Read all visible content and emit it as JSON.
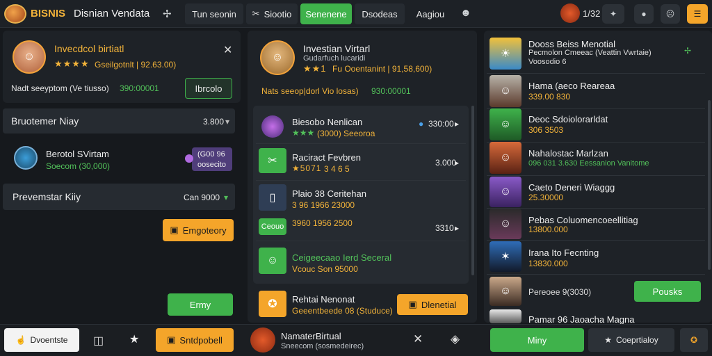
{
  "header": {
    "brand": "BISNIS",
    "title": "Disnian Vendata",
    "tabs": [
      "Tun seonin",
      "Siootio",
      "Senenene",
      "Dsodeas",
      "Aagiou"
    ],
    "counter": "1/32",
    "colors": {
      "accent": "#3fb24b",
      "brand": "#f4a52a"
    }
  },
  "left": {
    "profile_name": "Invecdcol birtiatl",
    "profile_stars": "★★★★",
    "profile_line": "Gseilgotnlt | 92.63.00)",
    "meta_text": "Nadt seeyptom (Ve tiusso)",
    "meta_value": "390:00001",
    "action_label": "Ibrcolo",
    "row1_title": "Bruotemer Niay",
    "row1_value": "3.800",
    "item_title": "Berotol SVirtam",
    "item_sub": "Soecom (30,000)",
    "item_badge_top": "(G00 96",
    "item_badge_bottom": "oosecito",
    "row2_title": "Prevemstar Kiiy",
    "row2_value": "Can 9000",
    "orange_btn": "Emgoteory",
    "green_btn": "Ermy",
    "footer_btn1": "Dvoentste",
    "footer_btn2": "Sntdpobell"
  },
  "middle": {
    "profile_name": "Investian Virtarl",
    "profile_sub": "Gudarfuch lucaridi",
    "profile_stars": "★★1",
    "profile_line": "Fu Ooentanint | 91,58,600)",
    "meta_text": "Nats seeop|dorl Vio losas)",
    "meta_value": "930:00001",
    "items": [
      {
        "title": "Biesobo Nenlican",
        "stars": "★★★",
        "sub": "(3000) Seeoroa",
        "value": "330:00"
      },
      {
        "title": "Raciract Fevbren",
        "stars": "★5071",
        "sub": "3 4 6 5",
        "value": "3.000"
      },
      {
        "title": "Plaio 38 Ceritehan",
        "stars": "",
        "sub": "3 96  1966  23000",
        "value": ""
      },
      {
        "title": "Ceouo",
        "stars": "",
        "sub": "3960  1956  2500",
        "value": "3310"
      },
      {
        "title": "Ceigeecaao Ierd Seceral",
        "stars": "",
        "sub": "Vcouc Son 95000",
        "value": ""
      }
    ],
    "bottom_title": "Rehtai Nenonat",
    "bottom_sub": "Geeentbeede 08 (Studuce)",
    "bottom_btn": "Dlenetial",
    "footer_title": "NamaterBirtual",
    "footer_sub": "Sneecom (sosmedeirec)"
  },
  "right": {
    "items": [
      {
        "title": "Dooss Beiss Menotial",
        "sub": "Pecmolon Cmeeac (Veattin Vwrtaie)",
        "sub2": "Voosodio 6"
      },
      {
        "title": "Hama (aeco Reareaa",
        "sub": "339.00  830"
      },
      {
        "title": "Deoc Sdoiolorarldat",
        "sub": "306  3503"
      },
      {
        "title": "Nahalostac Marlzan",
        "sub": "096 031 3.630  Eessanion Vanitome"
      },
      {
        "title": "Caeto Deneri Wiaggg",
        "sub": "25.30000"
      },
      {
        "title": "Pebas Coluomencoeellitiag",
        "sub": "13800.000"
      },
      {
        "title": "Irana Ito Fecnting",
        "sub": "13830.000"
      },
      {
        "title": "Pereoee 9(3030)",
        "sub": ""
      },
      {
        "title": "Pamar 96 Jaoacha Magna",
        "sub": ""
      }
    ],
    "green_btn": "Pousks",
    "footer_green": "Miny",
    "footer_dark": "Coeprtialoy"
  }
}
